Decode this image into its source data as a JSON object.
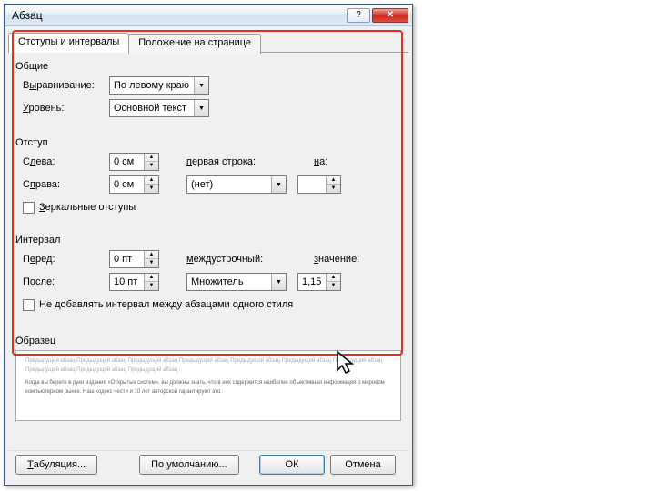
{
  "title": "Абзац",
  "tabs": {
    "indents": "Отступы и интервалы",
    "position": "Положение на странице"
  },
  "general": {
    "header": "Общие",
    "align_label_pre": "В",
    "align_label_u": "ы",
    "align_label_post": "равнивание:",
    "align_value": "По левому краю",
    "level_label_u": "У",
    "level_label_post": "ровень:",
    "level_value": "Основной текст"
  },
  "indent": {
    "header": "Отступ",
    "left_label": "Слева:",
    "left_label_u": "л",
    "left_value": "0 см",
    "right_label": "Справа:",
    "right_label_u": "п",
    "right_value": "0 см",
    "firstline_label": "первая строка:",
    "firstline_label_u": "п",
    "firstline_value": "(нет)",
    "by_label_u": "н",
    "by_label_post": "а:",
    "by_value": "",
    "mirror": "Зеркальные отступы",
    "mirror_u": "З"
  },
  "spacing": {
    "header": "Интервал",
    "before_label": "Перед:",
    "before_label_u": "е",
    "before_value": "0 пт",
    "after_label": "После:",
    "after_label_u": "о",
    "after_value": "10 пт",
    "line_label_u": "м",
    "line_label_post": "еждустрочный:",
    "line_value": "Множитель",
    "at_label_u": "з",
    "at_label_post": "начение:",
    "at_value": "1,15",
    "nospace": "Не добавлять интервал между абзацами одного стиля"
  },
  "preview": {
    "header": "Образец",
    "greek": "Предыдущий абзац Предыдущий абзац Предыдущий абзац Предыдущий абзац Предыдущий абзац Предыдущий абзац Предыдущий абзац Предыдущий абзац Предыдущий абзац Предыдущий абзац",
    "sample": "Когда вы берете в руки издания «Открытых систем», вы должны знать, что в них содержится наиболее объективная информация о мировом компьютерном рынке. Наш кодекс чести и 10 лет авторской гарантируют это."
  },
  "buttons": {
    "tabs": "Табуляция...",
    "default": "По умолчанию...",
    "ok": "ОК",
    "cancel": "Отмена"
  }
}
